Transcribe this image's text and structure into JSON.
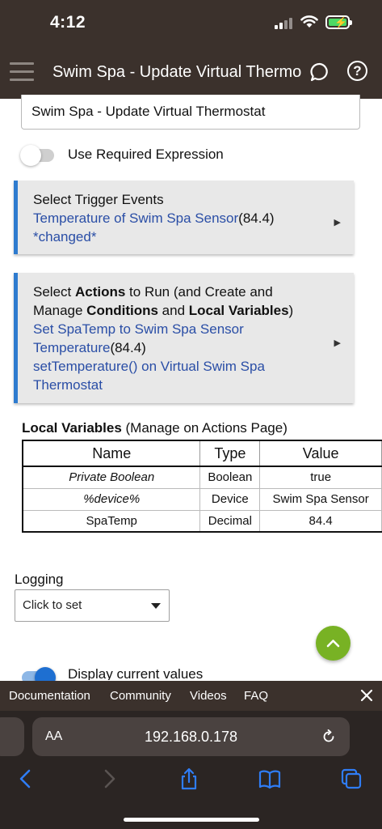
{
  "status": {
    "time": "4:12"
  },
  "header": {
    "title": "Swim Spa - Update Virtual Thermostat"
  },
  "rule_name": {
    "value": "Swim Spa - Update Virtual Thermostat"
  },
  "required_expression": {
    "label": "Use Required Expression",
    "enabled": false
  },
  "trigger_card": {
    "heading": "Select Trigger Events",
    "event_link": "Temperature of Swim Spa Sensor",
    "event_value": "(84.4)",
    "event_suffix": "*changed*"
  },
  "actions_card": {
    "h_select": "Select ",
    "h_actions": "Actions",
    "h_run": " to Run (and Create and Manage ",
    "h_conditions": "Conditions",
    "h_and": " and ",
    "h_localvars": "Local Variables",
    "h_close": ")",
    "action1_link": "Set SpaTemp to Swim Spa Sensor Temperature",
    "action1_value": "(84.4)",
    "action2": "setTemperature() on Virtual Swim Spa Thermostat"
  },
  "local_variables": {
    "title_bold": "Local Variables",
    "title_rest": " (Manage on Actions Page)",
    "headers": [
      "Name",
      "Type",
      "Value"
    ],
    "rows": [
      {
        "name": "Private Boolean",
        "type": "Boolean",
        "value": "true",
        "italic": true
      },
      {
        "name": "%device%",
        "type": "Device",
        "value": "Swim Spa Sensor",
        "italic": true
      },
      {
        "name": "SpaTemp",
        "type": "Decimal",
        "value": "84.4",
        "italic": false
      }
    ]
  },
  "logging": {
    "label": "Logging",
    "selected": "Click to set"
  },
  "display_values": {
    "label": "Display current values",
    "enabled": true
  },
  "footer": {
    "links": [
      "Documentation",
      "Community",
      "Videos",
      "FAQ"
    ]
  },
  "browser": {
    "text_size": "AA",
    "url": "192.168.0.178"
  },
  "colors": {
    "header_bg": "#3b312c",
    "accent_blue": "#2e7bcf",
    "link_blue": "#2a4ea6",
    "fab_green": "#78b224"
  }
}
